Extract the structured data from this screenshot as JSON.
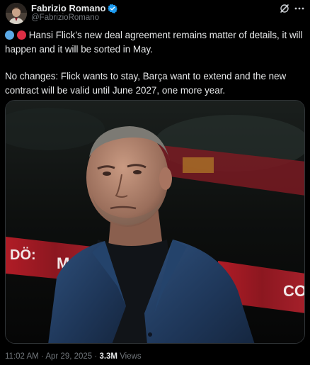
{
  "author": {
    "name": "Fabrizio Romano",
    "handle": "@FabrizioRomano",
    "verified": true,
    "avatar_icon": "profile-photo"
  },
  "tweet": {
    "paragraph1": "Hansi Flick’s new deal agreement remains matter of details, it will happen and it will be sorted in May.",
    "paragraph2": "No changes: Flick wants to stay, Barça want to extend and the new contract will be valid until June 2027, one more year.",
    "emojis": [
      "blue-circle-emoji",
      "red-circle-emoji"
    ],
    "image_alt_banner_text_left": "DÖ:",
    "image_alt_banner_text_mid": "MA",
    "image_alt_banner_text_right": "CO"
  },
  "footer": {
    "time": "11:02 AM",
    "separator": " · ",
    "date": "Apr 29, 2025",
    "views_count": "3.3M",
    "views_label": "Views"
  },
  "header_actions": {
    "grok_icon": "grok-icon",
    "more_icon": "more-options-icon"
  },
  "colors": {
    "background": "#000000",
    "text_primary": "#e7e9ea",
    "text_secondary": "#71767b",
    "verified_badge": "#1d9bf0",
    "emoji_blue": "#5aa9e6",
    "emoji_red": "#dd2e44"
  }
}
